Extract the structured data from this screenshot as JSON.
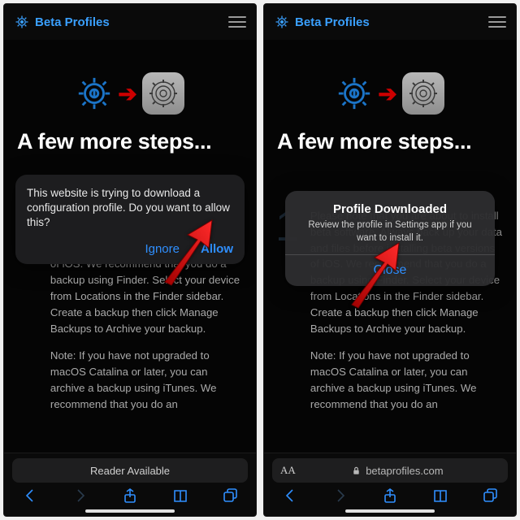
{
  "colors": {
    "link": "#2f8fff",
    "brand": "#3aa0ff",
    "arrow": "#cc0000"
  },
  "brand_name": "Beta Profiles",
  "heading": "A few more steps...",
  "step_number": "1",
  "step_text": "Please note that you are about to install beta software. Always back up your data and files before installing beta versions of iOS. We recommend that you do a backup using Finder. Select your device from Locations in the Finder sidebar. Create a backup then click Manage Backups to Archive your backup.",
  "step_note": "Note: If you have not upgraded to macOS Catalina or later, you can archive a backup using iTunes. We recommend that you do an",
  "alert1": {
    "message": "This website is trying to download a configuration profile. Do you want to allow this?",
    "ignore": "Ignore",
    "allow": "Allow"
  },
  "alert2": {
    "title": "Profile Downloaded",
    "subtitle": "Review the profile in Settings app if you want to install it.",
    "close": "Close"
  },
  "safari": {
    "reader": "Reader Available",
    "aA": "AA",
    "host": "betaprofiles.com"
  }
}
